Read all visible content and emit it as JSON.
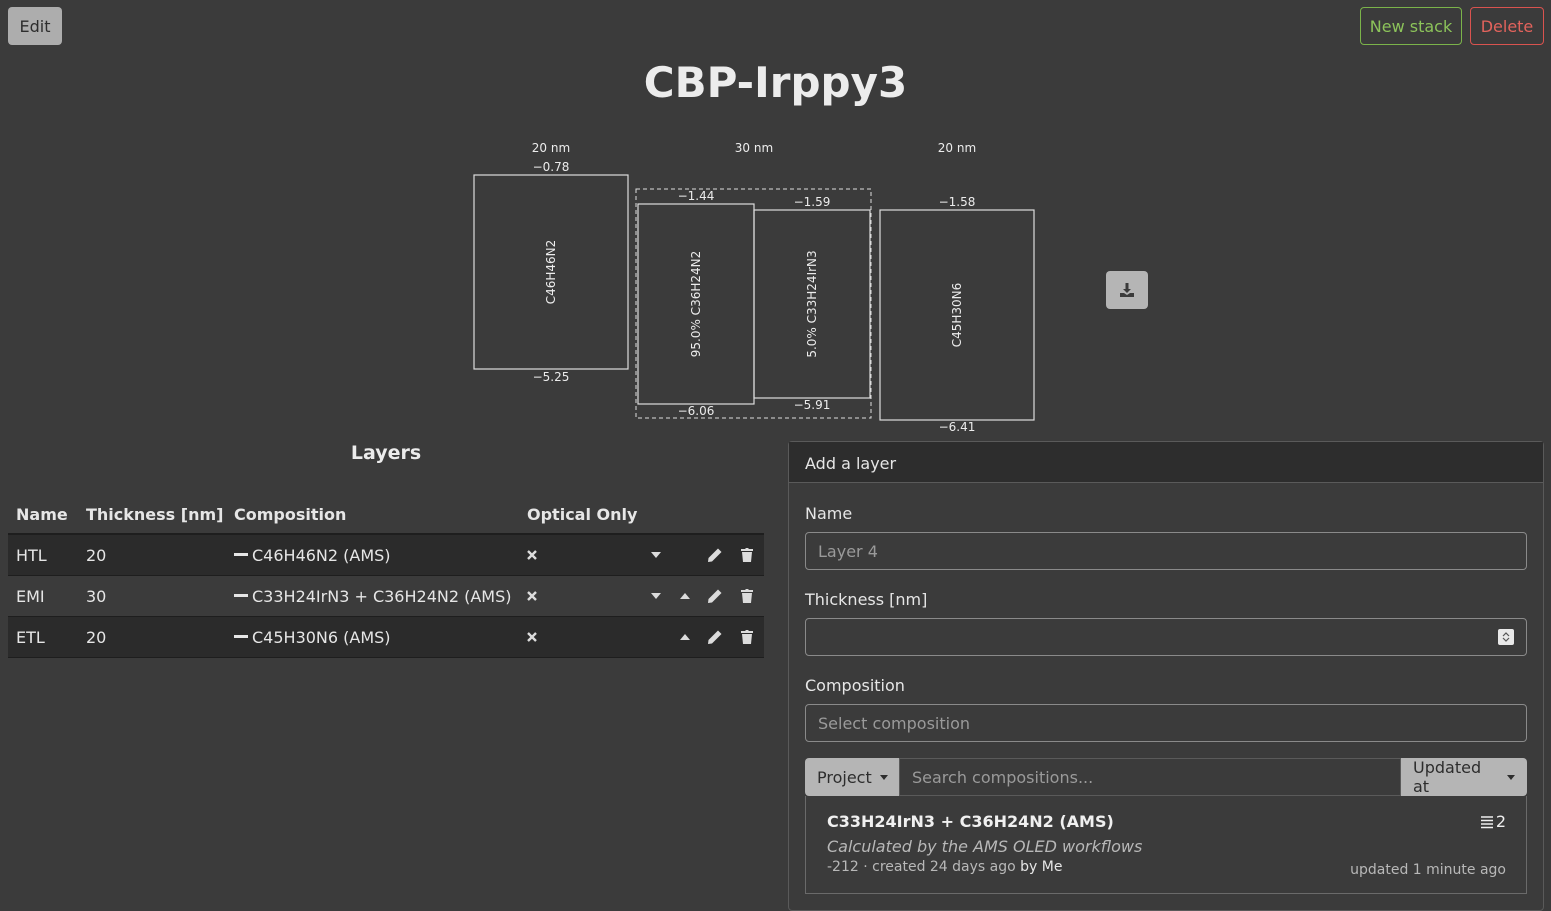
{
  "toolbar": {
    "edit_label": "Edit",
    "new_stack_label": "New stack",
    "delete_label": "Delete"
  },
  "stack_title": "CBP-Irppy3",
  "energy_diagram": {
    "layers": [
      {
        "thickness": "20 nm",
        "top": "−0.78",
        "bottom": "−5.25",
        "label": "C46H46N2"
      },
      {
        "thickness": "30 nm",
        "components": [
          {
            "top": "−1.44",
            "bottom": "−6.06",
            "label": "95.0% C36H24N2"
          },
          {
            "top": "−1.59",
            "bottom": "−5.91",
            "label": "5.0% C33H24IrN3"
          }
        ]
      },
      {
        "thickness": "20 nm",
        "top": "−1.58",
        "bottom": "−6.41",
        "label": "C45H30N6"
      }
    ],
    "download_icon": "download-icon"
  },
  "layers_table": {
    "heading": "Layers",
    "columns": [
      "Name",
      "Thickness [nm]",
      "Composition",
      "Optical Only"
    ],
    "rows": [
      {
        "name": "HTL",
        "thickness": "20",
        "composition": "C46H46N2 (AMS)"
      },
      {
        "name": "EMI",
        "thickness": "30",
        "composition": "C33H24IrN3 + C36H24N2 (AMS)"
      },
      {
        "name": "ETL",
        "thickness": "20",
        "composition": "C45H30N6 (AMS)"
      }
    ]
  },
  "add_layer": {
    "header": "Add a layer",
    "name_label": "Name",
    "name_placeholder": "Layer 4",
    "thickness_label": "Thickness [nm]",
    "composition_label": "Composition",
    "composition_placeholder": "Select composition",
    "project_label": "Project",
    "search_placeholder": "Search compositions...",
    "sort_label": "Updated at",
    "result": {
      "title": "C33H24IrN3 + C36H24N2 (AMS)",
      "description": "Calculated by the AMS OLED workflows",
      "meta": "-212 ·  created 24 days ago ",
      "by": "by Me",
      "count": "2",
      "updated": "updated 1 minute ago"
    }
  }
}
